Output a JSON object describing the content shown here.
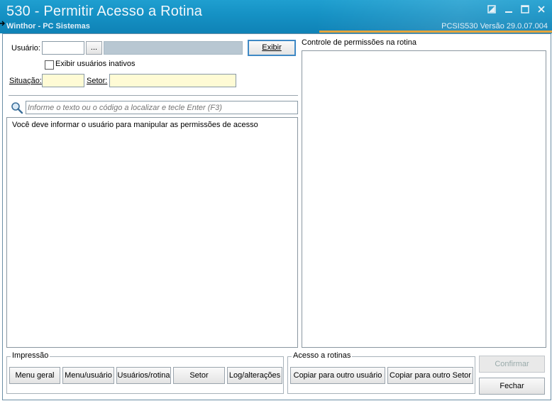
{
  "window": {
    "title": "530 - Permitir Acesso a Rotina",
    "subtitle": "Winthor - PC Sistemas",
    "version": "PCSIS530  Versão  29.0.07.004",
    "buttons": {
      "restore": "restore-icon",
      "minimize": "minimize-icon",
      "maximize": "maximize-icon",
      "close": "close-icon"
    }
  },
  "form": {
    "usuario_label": "Usuário:",
    "usuario_value": "",
    "browse_label": "...",
    "usuario_name": "",
    "exibir_label": "Exibir",
    "inativos_label": "Exibir usuários inativos",
    "situacao_label": "Situação:",
    "situacao_value": "",
    "setor_label": "Setor:",
    "setor_value": ""
  },
  "search": {
    "icon": "search-icon",
    "placeholder": "Informe o texto ou o código a localizar e tecle Enter (F3)"
  },
  "left_panel": {
    "message": "Você deve informar o usuário para manipular as permissões de acesso"
  },
  "right_panel": {
    "title": "Controle de permissões na rotina"
  },
  "impressao": {
    "title": "Impressão",
    "buttons": [
      "Menu geral",
      "Menu/usuário",
      "Usuários/rotina",
      "Setor",
      "Log/alterações"
    ]
  },
  "acesso": {
    "title": "Acesso a rotinas",
    "buttons": [
      "Copiar para outro usuário",
      "Copiar para outro Setor"
    ]
  },
  "actions": {
    "confirmar": "Confirmar",
    "fechar": "Fechar"
  }
}
